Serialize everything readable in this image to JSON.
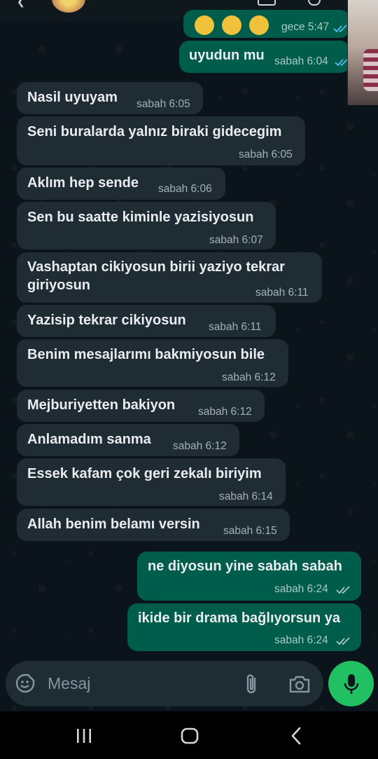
{
  "header": {
    "partial_prev_time": "gece 5:47"
  },
  "messages": [
    {
      "dir": "out",
      "text": "uyudun mu",
      "time": "sabah 6:04",
      "status": "read"
    },
    {
      "dir": "in",
      "text": "Nasil uyuyam",
      "time": "sabah 6:05"
    },
    {
      "dir": "in",
      "text": "Seni buralarda yalnız biraki gidecegim",
      "time": "sabah 6:05"
    },
    {
      "dir": "in",
      "text": "Aklım hep sende",
      "time": "sabah 6:06"
    },
    {
      "dir": "in",
      "text": "Sen bu saatte kiminle yazisiyosun",
      "time": "sabah 6:07"
    },
    {
      "dir": "in",
      "text_line1": "Vashaptan cikiyosun birii yaziyo tekrar",
      "text_line2": "giriyosun",
      "time": "sabah 6:11"
    },
    {
      "dir": "in",
      "text": "Yazisip tekrar cikiyosun",
      "time": "sabah 6:11"
    },
    {
      "dir": "in",
      "text": "Benim mesajlarımı bakmiyosun bile",
      "time": "sabah 6:12"
    },
    {
      "dir": "in",
      "text": "Mejburiyetten bakiyon",
      "time": "sabah 6:12"
    },
    {
      "dir": "in",
      "text": "Anlamadım sanma",
      "time": "sabah 6:12"
    },
    {
      "dir": "in",
      "text": "Essek kafam çok geri zekalı biriyim",
      "time": "sabah 6:14"
    },
    {
      "dir": "in",
      "text": "Allah benim belamı versin",
      "time": "sabah 6:15"
    },
    {
      "dir": "out",
      "text": "ne diyosun yine sabah sabah",
      "time": "sabah 6:24",
      "status": "delivered"
    },
    {
      "dir": "out",
      "text": "ikide bir drama bağlıyorsun ya",
      "time": "sabah 6:24",
      "status": "delivered"
    }
  ],
  "composer": {
    "placeholder": "Mesaj",
    "icons": [
      "emoji-icon",
      "attach-icon",
      "camera-icon",
      "mic-icon"
    ]
  },
  "colors": {
    "background": "#0b141a",
    "incoming_bubble": "#1f2c34",
    "outgoing_bubble": "#005c4b",
    "accent": "#21c063",
    "read_ticks": "#53bdeb"
  }
}
